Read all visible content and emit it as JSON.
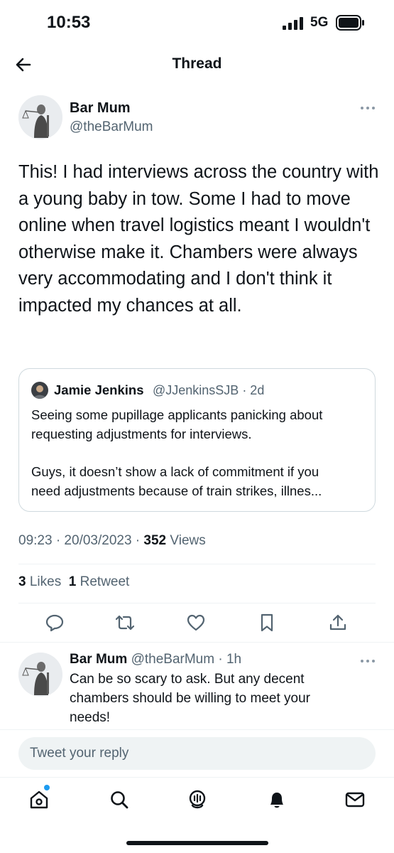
{
  "status_bar": {
    "time": "10:53",
    "network": "5G"
  },
  "header": {
    "title": "Thread"
  },
  "tweet": {
    "author_name": "Bar Mum",
    "author_handle": "@theBarMum",
    "text": "This! I had interviews across the country with a young baby in tow. Some I had to move online when travel logistics meant I wouldn't otherwise make it. Chambers were always very accommodating and I don't think it impacted my chances at all.",
    "quoted": {
      "author_name": "Jamie Jenkins",
      "author_handle": "@JJenkinsSJB · 2d",
      "lines": [
        "Seeing some pupillage applicants panicking about",
        "requesting adjustments for interviews.",
        "Guys, it doesn’t show a lack of commitment if you",
        "need adjustments because of train strikes, illnes..."
      ]
    },
    "timestamp": "09:23 · 20/03/2023 · ",
    "views_count": "352",
    "views_label": " Views",
    "likes_count": "3",
    "likes_label": " Likes",
    "retweets_count": "1",
    "retweets_label": " Retweet"
  },
  "actions": [
    "reply-icon",
    "retweet-icon",
    "like-icon",
    "bookmark-icon",
    "share-icon"
  ],
  "reply": {
    "author_name": "Bar Mum",
    "author_meta": " @theBarMum · 1h",
    "lines": [
      "Can be so scary to ask. But any decent",
      "chambers should be willing to meet your",
      "needs!"
    ]
  },
  "reply_box": {
    "placeholder": "Tweet your reply"
  },
  "tab_bar": [
    "home-icon",
    "search-icon",
    "spaces-icon",
    "notifications-icon",
    "messages-icon"
  ],
  "colors": {
    "accent": "#1d9bf0",
    "text": "#0f1419",
    "muted": "#536471",
    "border": "#cfd9de"
  }
}
